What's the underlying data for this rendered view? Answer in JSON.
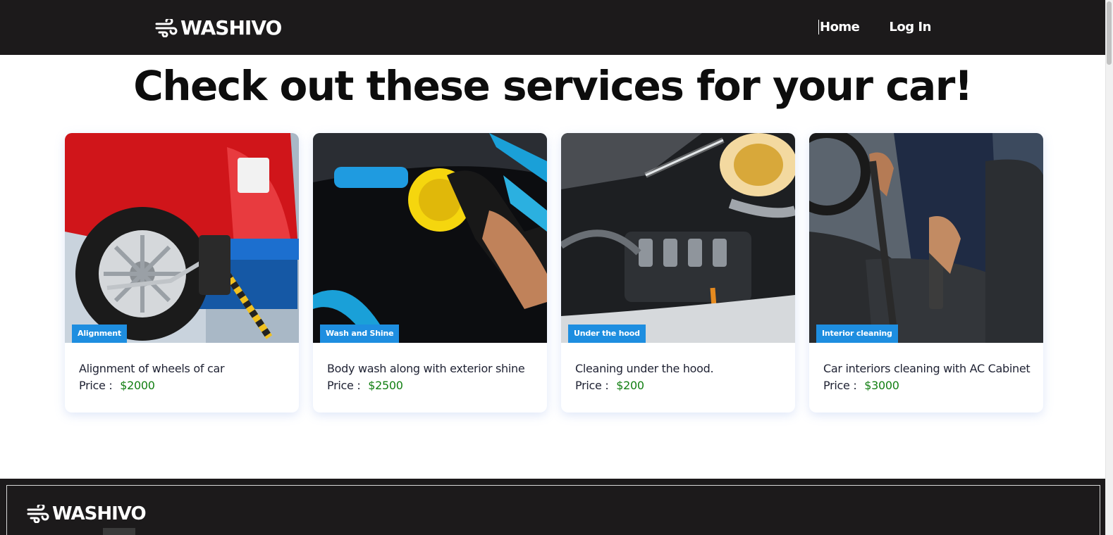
{
  "header": {
    "brand": "WASHIVO",
    "nav": [
      {
        "label": "Home"
      },
      {
        "label": "Log In"
      }
    ]
  },
  "main": {
    "title": "Check out these services for your car!",
    "price_label": "Price :",
    "cards": [
      {
        "tag": "Alignment",
        "title": "Alignment of wheels of car",
        "price": "$2000",
        "image": "wheel-alignment-photo"
      },
      {
        "tag": "Wash and Shine",
        "title": "Body wash along with exterior shine",
        "price": "$2500",
        "image": "car-polishing-photo"
      },
      {
        "tag": "Under the hood",
        "title": "Cleaning under the hood.",
        "price": "$200",
        "image": "engine-cleaning-photo"
      },
      {
        "tag": "Interior cleaning",
        "title": "Car interiors cleaning with AC Cabinet",
        "price": "$3000",
        "image": "interior-vacuum-photo"
      }
    ]
  },
  "footer": {
    "brand": "WASHIVO"
  },
  "colors": {
    "navbar": "#1c1a1b",
    "tag": "#1e8ee0",
    "price": "#127f12"
  }
}
